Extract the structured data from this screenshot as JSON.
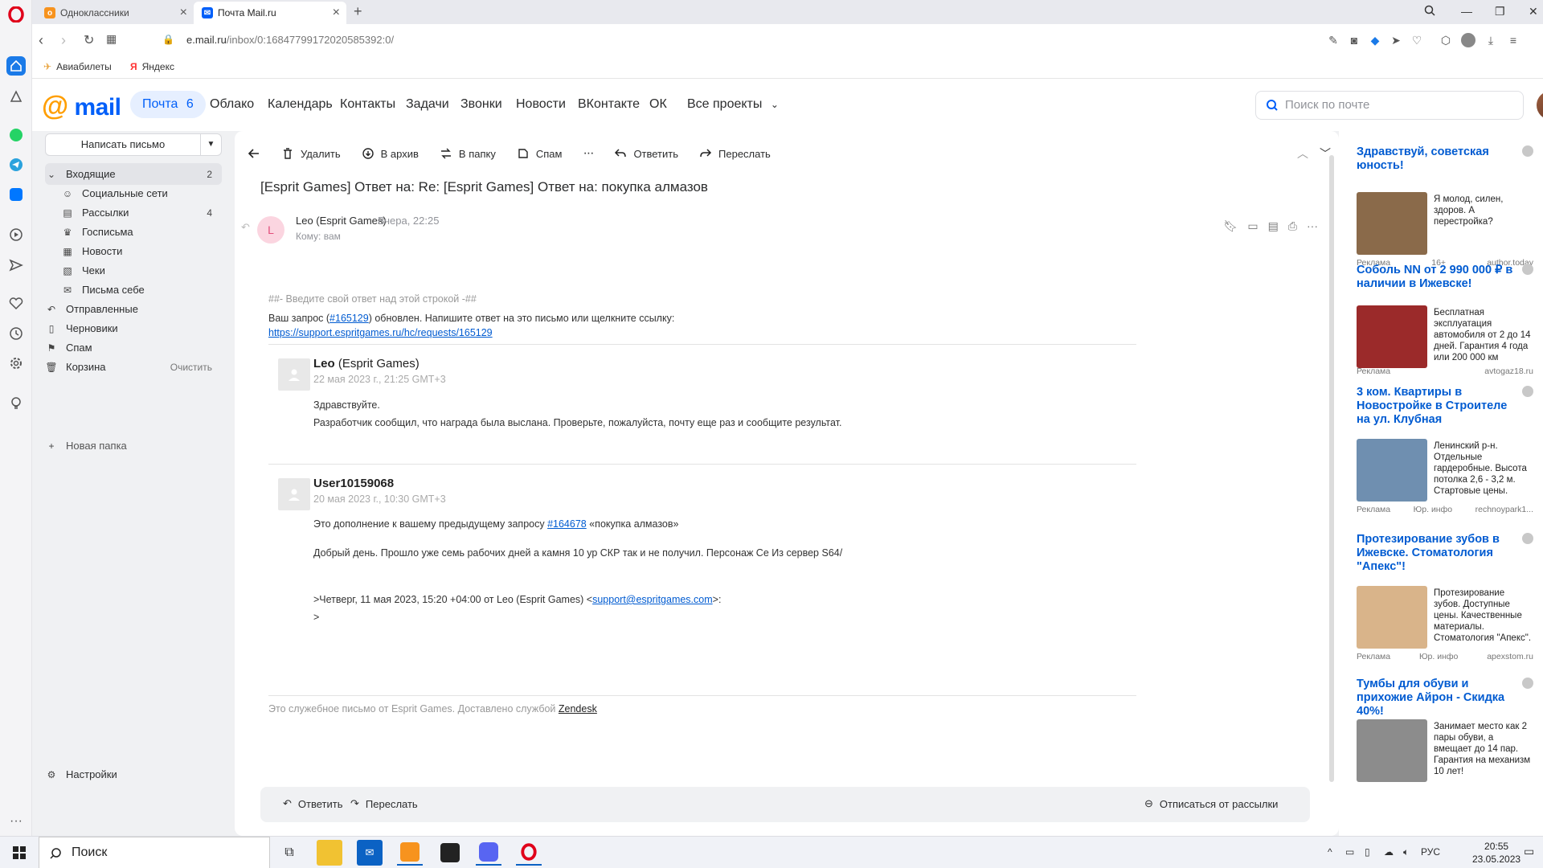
{
  "browser": {
    "tabs": [
      {
        "title": "Одноклассники",
        "active": false
      },
      {
        "title": "Почта Mail.ru",
        "active": true
      }
    ],
    "url_host": "e.mail.ru",
    "url_path": "/inbox/0:16847799172020585392:0/",
    "bookmarks": [
      {
        "label": "Авиабилеты",
        "icon": "plane-icon"
      },
      {
        "label": "Яндекс",
        "icon": "yandex-icon"
      }
    ]
  },
  "mail": {
    "nav": [
      {
        "label": "Почта",
        "badge": "6",
        "active": true
      },
      {
        "label": "Облако"
      },
      {
        "label": "Календарь"
      },
      {
        "label": "Контакты"
      },
      {
        "label": "Задачи"
      },
      {
        "label": "Звонки"
      },
      {
        "label": "Новости"
      },
      {
        "label": "ВКонтакте"
      },
      {
        "label": "ОК"
      },
      {
        "label": "Все проекты"
      }
    ],
    "search_placeholder": "Поиск по почте",
    "compose_label": "Написать письмо",
    "folders": [
      {
        "label": "Входящие",
        "count": "2",
        "icon": "chevron-down-icon",
        "active": true
      },
      {
        "label": "Социальные сети",
        "icon": "users-icon",
        "sub": true
      },
      {
        "label": "Рассылки",
        "count": "4",
        "icon": "newsletter-icon",
        "sub": true
      },
      {
        "label": "Госписьма",
        "icon": "emblem-icon",
        "sub": true
      },
      {
        "label": "Новости",
        "icon": "news-icon",
        "sub": true
      },
      {
        "label": "Чеки",
        "icon": "receipt-icon",
        "sub": true
      },
      {
        "label": "Письма себе",
        "icon": "self-mail-icon",
        "sub": true
      },
      {
        "label": "Отправленные",
        "icon": "sent-icon"
      },
      {
        "label": "Черновики",
        "icon": "draft-icon"
      },
      {
        "label": "Спам",
        "icon": "spam-icon"
      },
      {
        "label": "Корзина",
        "icon": "trash-icon",
        "action": "Очистить"
      }
    ],
    "new_folder": "Новая папка",
    "settings": "Настройки"
  },
  "toolbar": {
    "delete": "Удалить",
    "archive": "В архив",
    "move": "В папку",
    "spam": "Спам",
    "reply": "Ответить",
    "forward": "Переслать"
  },
  "message": {
    "subject": "[Esprit Games] Ответ на: Re: [Esprit Games] Ответ на: покупка алмазов",
    "sender_initial": "L",
    "sender": "Leo (Esprit Games)",
    "time": "Вчера, 22:25",
    "to": "Кому: вам",
    "reply_line": "##- Введите свой ответ над этой строкой -##",
    "request_pre": "Ваш запрос (",
    "request_id": "#165129",
    "request_post": ") обновлен. Напишите ответ на это письмо или щелкните ссылку:",
    "request_url": "https://support.espritgames.ru/hc/requests/165129",
    "entries": [
      {
        "name": "Leo",
        "name_suffix": " (Esprit Games)",
        "date": "22 мая 2023 г., 21:25 GMT+3",
        "line1": "Здравствуйте.",
        "line2": "Разработчик сообщил, что награда была выслана. Проверьте, пожалуйста, почту еще раз и сообщите результат."
      },
      {
        "name": "User10159068",
        "date": "20 мая 2023 г., 10:30 GMT+3",
        "line1_pre": "Это дополнение к вашему предыдущему запросу ",
        "line1_link": "#164678",
        "line1_post": " «покупка алмазов»",
        "line2": "Добрый день. Прошло уже семь рабочих дней а камня 10 ур СКР так и не получил. Персонаж Се Из сервер S64/",
        "quote_pre": ">Четверг, 11 мая 2023, 15:20 +04:00 от Leo (Esprit Games) <",
        "quote_email": "support@espritgames.com",
        "quote_post": ">:",
        "quote_end": ">"
      }
    ],
    "footer_pre": "Это служебное письмо от Esprit Games. Доставлено службой ",
    "footer_link": "Zendesk",
    "reply_btn": "Ответить",
    "forward_btn": "Переслать",
    "unsubscribe": "Отписаться от рассылки"
  },
  "ads": [
    {
      "title": "Здравствуй, советская юность!",
      "text": "Я молод, силен, здоров. А перестройка?",
      "label": "Реклама",
      "mid": "16+",
      "source": "author.today",
      "color": "#8a6a4a"
    },
    {
      "title": "Соболь NN от 2 990 000 ₽ в наличии в Ижевске!",
      "text": "Бесплатная эксплуатация автомобиля от 2 до 14 дней. Гарантия 4 года или 200 000 км",
      "label": "Реклама",
      "mid": "",
      "source": "avtogaz18.ru",
      "color": "#9b2a2a"
    },
    {
      "title": "3 ком. Квартиры в Новостройке в Строителе на ул. Клубная",
      "text": "Ленинский р-н. Отдельные гардеробные. Высота потолка 2,6 - 3,2 м. Стартовые цены.",
      "label": "Реклама",
      "mid": "Юр. инфо",
      "source": "rechnoypark1...",
      "color": "#6f8fb0"
    },
    {
      "title": "Протезирование зубов в Ижевске. Стоматология \"Апекс\"!",
      "text": "Протезирование зубов. Доступные цены. Качественные материалы. Стоматология \"Апекс\".",
      "label": "Реклама",
      "mid": "Юр. инфо",
      "source": "apexstom.ru",
      "color": "#d9b48a"
    },
    {
      "title": "Тумбы для обуви и прихожие Айрон - Скидка 40%!",
      "text": "Занимает место как 2 пары обуви, а вмещает до 14 пар. Гарантия на механизм 10 лет!",
      "label": "",
      "mid": "",
      "source": "",
      "color": "#8c8c8c"
    }
  ],
  "taskbar": {
    "search": "Поиск",
    "lang": "РУС",
    "time": "20:55",
    "date": "23.05.2023"
  }
}
